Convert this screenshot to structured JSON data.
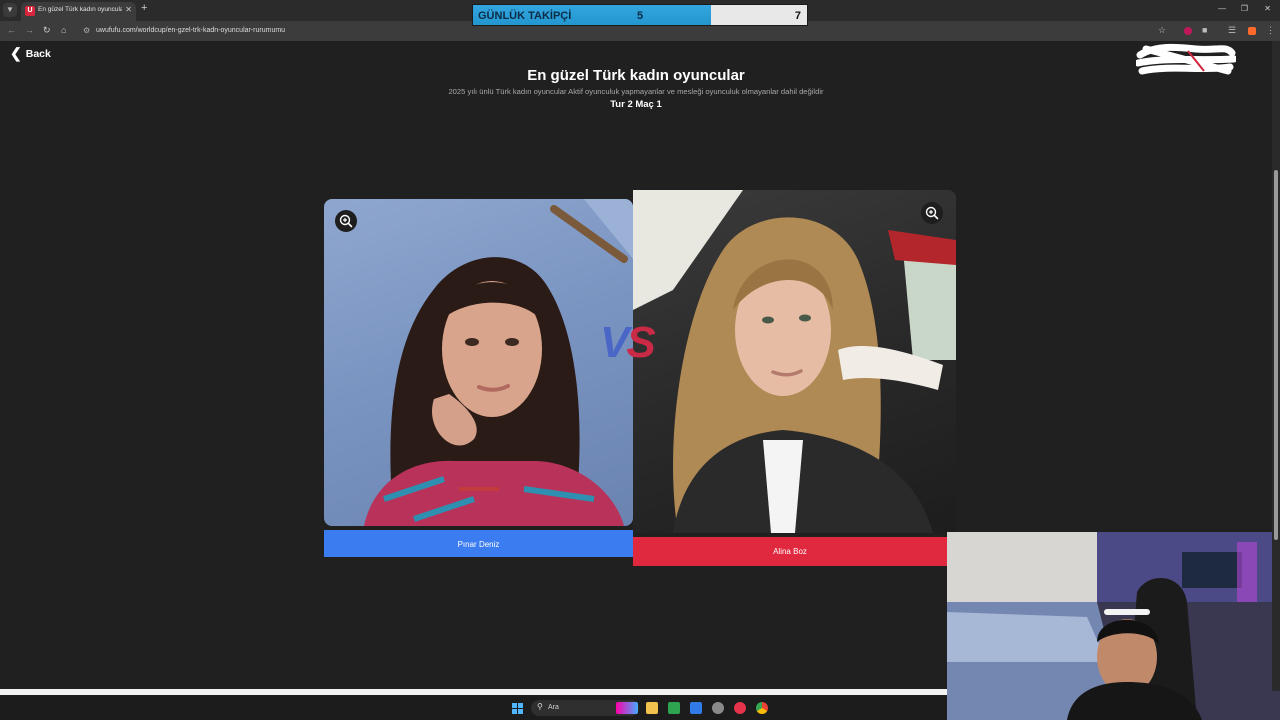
{
  "browser": {
    "tab_title": "En güzel Türk kadın oyuncular | ...",
    "tab_favicon": "U",
    "url": "uwufufu.com/worldcup/en-gzel-trk-kadn-oyuncular-rurumumu",
    "icons": [
      "chevron-down-icon",
      "close-icon",
      "plus-icon",
      "back-arrow-icon",
      "forward-arrow-icon",
      "reload-icon",
      "home-icon",
      "site-info-icon",
      "star-icon",
      "extensions-icon"
    ]
  },
  "overlay": {
    "label": "GÜNLÜK TAKİPÇİ",
    "current": "5",
    "goal": "7",
    "progress": 0.714
  },
  "page": {
    "back_label": "Back",
    "title": "En güzel Türk kadın oyuncular",
    "subtitle": "2025 yılı ünlü Türk kadın oyuncular Aktif oyunculuk yapmayanlar ve mesleği oyunculuk olmayanlar dahil değildir",
    "round": "Tur 2 Maç 1"
  },
  "matchup": {
    "left_name": "Pınar Deniz",
    "right_name": "Alina Boz",
    "vs_v": "V",
    "vs_s": "S"
  },
  "taskbar": {
    "search_label": "Ara"
  },
  "colors": {
    "background": "#202020",
    "left_button": "#3b7cf0",
    "right_button": "#e0283f",
    "counter_fill": "#2496cf"
  }
}
